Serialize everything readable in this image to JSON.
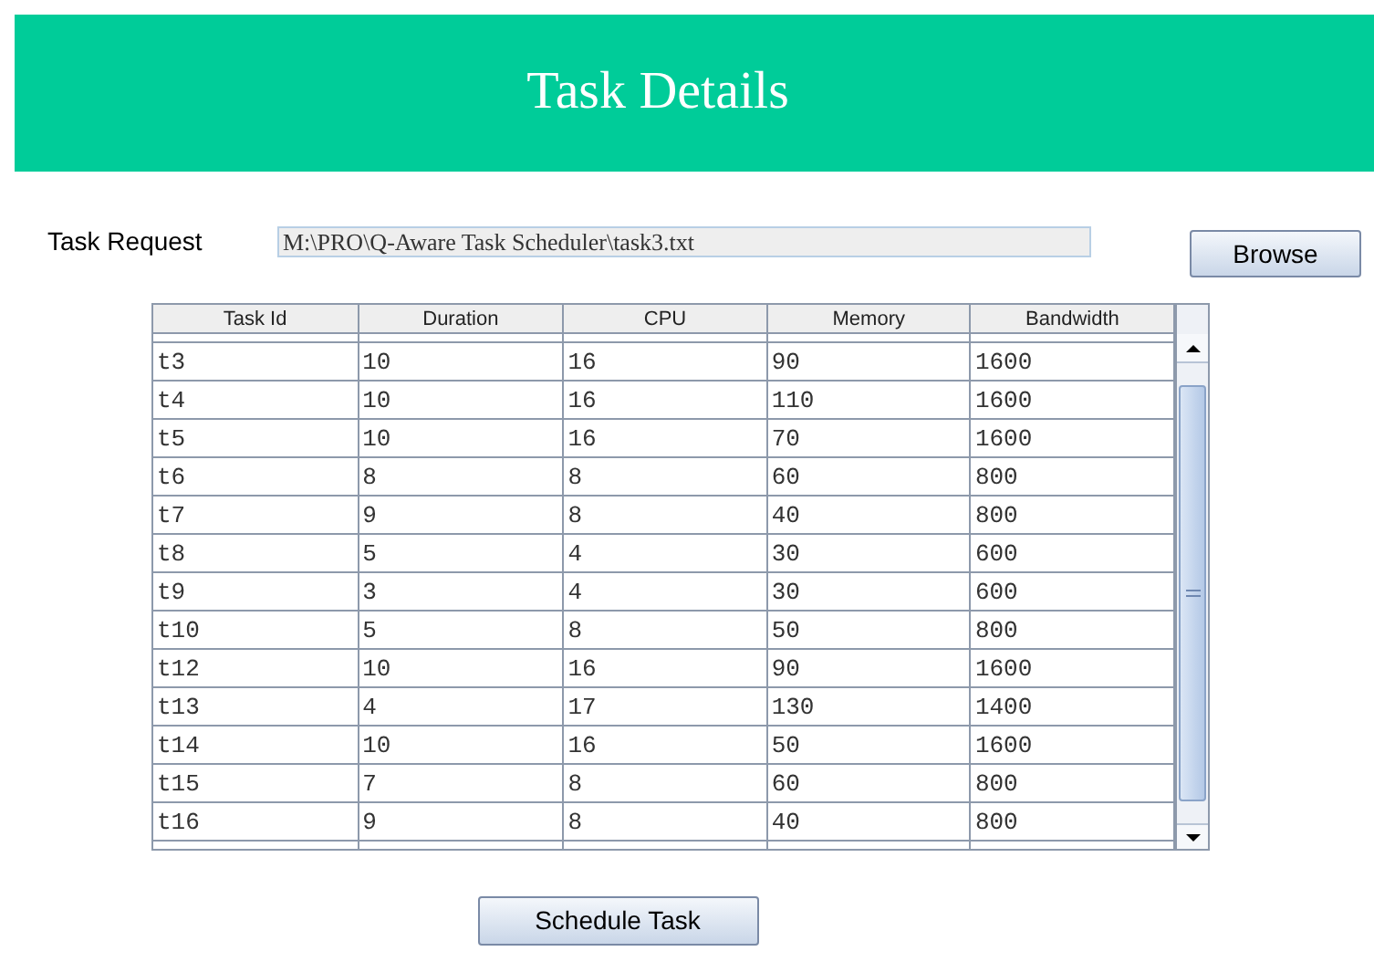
{
  "header": {
    "title": "Task Details"
  },
  "task_request": {
    "label": "Task Request",
    "value": "M:\\PRO\\Q-Aware Task Scheduler\\task3.txt",
    "browse_button": "Browse"
  },
  "table": {
    "columns": [
      "Task Id",
      "Duration",
      "CPU",
      "Memory",
      "Bandwidth"
    ],
    "rows": [
      [
        "t3",
        "10",
        "16",
        "90",
        "1600"
      ],
      [
        "t4",
        "10",
        "16",
        "110",
        "1600"
      ],
      [
        "t5",
        "10",
        "16",
        "70",
        "1600"
      ],
      [
        "t6",
        "8",
        "8",
        "60",
        "800"
      ],
      [
        "t7",
        "9",
        "8",
        "40",
        "800"
      ],
      [
        "t8",
        "5",
        "4",
        "30",
        "600"
      ],
      [
        "t9",
        "3",
        "4",
        "30",
        "600"
      ],
      [
        "t10",
        "5",
        "8",
        "50",
        "800"
      ],
      [
        "t12",
        "10",
        "16",
        "90",
        "1600"
      ],
      [
        "t13",
        "4",
        "17",
        "130",
        "1400"
      ],
      [
        "t14",
        "10",
        "16",
        "50",
        "1600"
      ],
      [
        "t15",
        "7",
        "8",
        "60",
        "800"
      ],
      [
        "t16",
        "9",
        "8",
        "40",
        "800"
      ]
    ]
  },
  "schedule_button": "Schedule Task"
}
